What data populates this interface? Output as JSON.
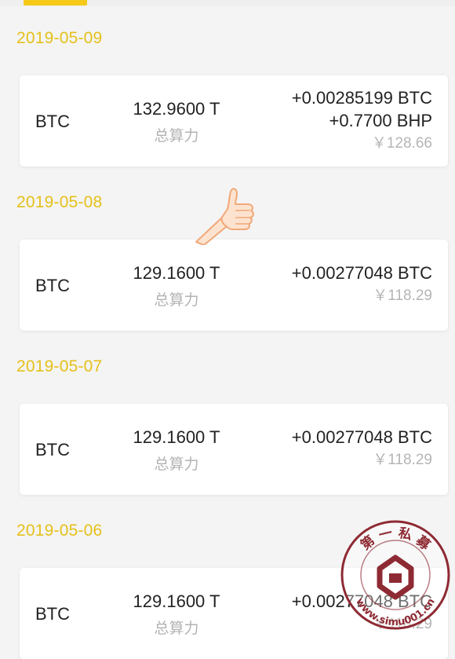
{
  "records": [
    {
      "date": "2019-05-09",
      "coin": "BTC",
      "hashrate": "132.9600 T",
      "hashrate_label": "总算力",
      "rewards": [
        "+0.00285199 BTC",
        "+0.7700 BHP"
      ],
      "cny": "￥128.66"
    },
    {
      "date": "2019-05-08",
      "coin": "BTC",
      "hashrate": "129.1600 T",
      "hashrate_label": "总算力",
      "rewards": [
        "+0.00277048 BTC"
      ],
      "cny": "￥118.29"
    },
    {
      "date": "2019-05-07",
      "coin": "BTC",
      "hashrate": "129.1600 T",
      "hashrate_label": "总算力",
      "rewards": [
        "+0.00277048 BTC"
      ],
      "cny": "￥118.29"
    },
    {
      "date": "2019-05-06",
      "coin": "BTC",
      "hashrate": "129.1600 T",
      "hashrate_label": "总算力",
      "rewards": [
        "+0.00277048 BTC"
      ],
      "cny": "￥118.29"
    }
  ],
  "watermark": {
    "top_text": "第 一 私 募",
    "url_text": "www.simu001.cn"
  },
  "colors": {
    "accent": "#f5c918",
    "date_text": "#e5c01a",
    "muted": "#b3b3b3",
    "seal": "#8e2a33"
  },
  "icons": [
    "thumbs-up-icon",
    "seal-logo-icon"
  ]
}
